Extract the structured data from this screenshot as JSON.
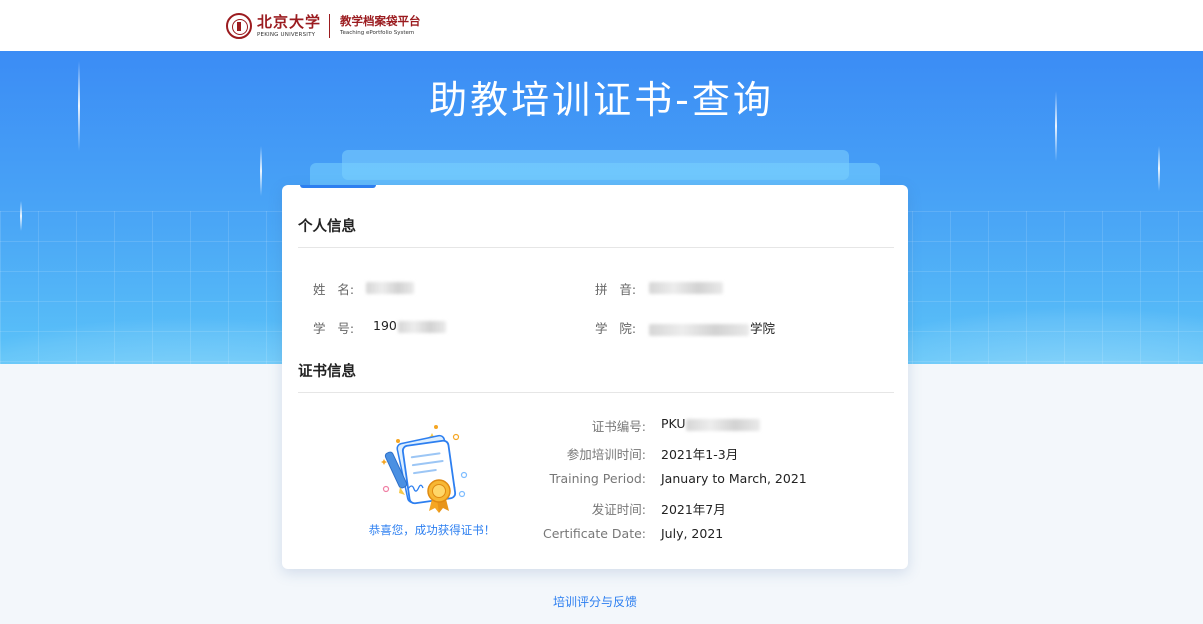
{
  "header": {
    "university_cn": "北京大学",
    "university_en": "PEKING UNIVERSITY",
    "platform_cn": "教学档案袋平台",
    "platform_en": "Teaching ePortfolio System"
  },
  "banner": {
    "title": "助教培训证书-查询"
  },
  "personal": {
    "section_title": "个人信息",
    "name_label": "姓   名:",
    "pinyin_label": "拼   音:",
    "student_id_label": "学   号:",
    "student_id_visible": "190",
    "school_label": "学   院:",
    "school_visible": "学院"
  },
  "certificate": {
    "section_title": "证书信息",
    "fields": [
      {
        "label": "证书编号:",
        "value": "PKU"
      },
      {
        "label": "参加培训时间:",
        "value": "2021年1-3月"
      },
      {
        "label": "Training Period:",
        "value": "January to March, 2021"
      },
      {
        "label": "发证时间:",
        "value": "2021年7月"
      },
      {
        "label": "Certificate Date:",
        "value": "July, 2021"
      }
    ],
    "congrats": "恭喜您，成功获得证书！"
  },
  "footer": {
    "feedback_link": "培训评分与反馈"
  },
  "colors": {
    "brand_red": "#9b1b1f",
    "accent_blue": "#2d7ff0"
  }
}
